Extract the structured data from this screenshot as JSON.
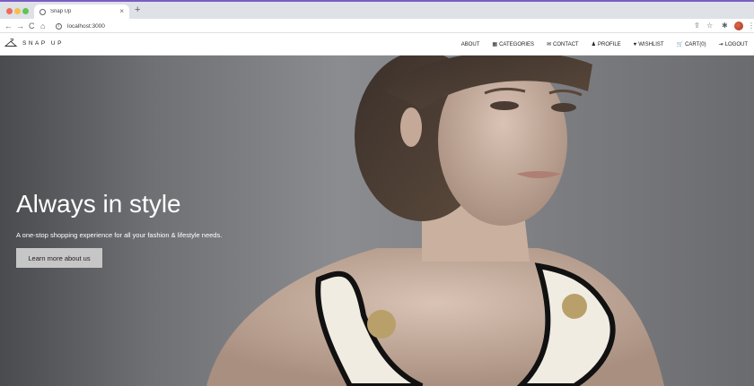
{
  "browser": {
    "tab_title": "Snap Up",
    "tab_close": "×",
    "new_tab": "+",
    "url": "localhost:3000",
    "nav_back": "←",
    "nav_forward": "→",
    "nav_reload": "C",
    "nav_home": "⌂",
    "info": "i",
    "share": "⇪",
    "star": "☆",
    "extensions": "✱",
    "menu": "⋮"
  },
  "site": {
    "brand": "SNAP UP",
    "nav": [
      {
        "label": "ABOUT",
        "icon": ""
      },
      {
        "label": "CATEGORIES",
        "icon": "▦"
      },
      {
        "label": "CONTACT",
        "icon": "✉"
      },
      {
        "label": "PROFILE",
        "icon": "♟"
      },
      {
        "label": "WISHLIST",
        "icon": "♥"
      },
      {
        "label": "CART(0)",
        "icon": "🛒"
      },
      {
        "label": "LOGOUT",
        "icon": "⇥"
      }
    ]
  },
  "hero": {
    "title": "Always in style",
    "subtitle": "A one-stop shopping experience for all your fashion & lifestyle needs.",
    "cta": "Learn more about us"
  },
  "colors": {
    "accent_strip": "#7b5cc4",
    "hero_bg": "#7a7b7f",
    "cta_bg": "#c6c6c6"
  }
}
